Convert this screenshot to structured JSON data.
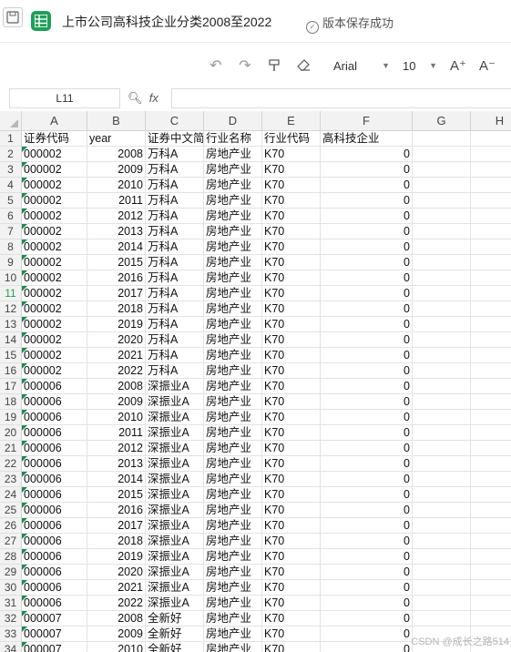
{
  "title_bar": {
    "doc_title": "上市公司高科技企业分类2008至2022",
    "save_status": "版本保存成功",
    "save_icon": "floppy-icon",
    "app_icon": "spreadsheet-app-icon"
  },
  "toolbar": {
    "font_name": "Arial",
    "font_size": "10",
    "undo_icon": "undo-icon",
    "redo_icon": "redo-icon",
    "format_painter_icon": "format-painter-icon",
    "clear_format_icon": "eraser-icon",
    "increase_font": "A⁺",
    "decrease_font": "A⁻"
  },
  "formula_bar": {
    "cell_ref": "L11",
    "zoom_icon": "magnifier-icon",
    "fx_label": "fx",
    "formula": ""
  },
  "columns": [
    "A",
    "B",
    "C",
    "D",
    "E",
    "F",
    "G",
    "H"
  ],
  "selected_row": 11,
  "rows": [
    {
      "n": "1",
      "a": "证券代码",
      "b": "year",
      "c": "证券中文简",
      "d": "行业名称",
      "e": "行业代码",
      "f": "高科技企业",
      "hdr": true
    },
    {
      "n": "2",
      "a": "000002",
      "b": "2008",
      "c": "万科A",
      "d": "房地产业",
      "e": "K70",
      "f": "0"
    },
    {
      "n": "3",
      "a": "000002",
      "b": "2009",
      "c": "万科A",
      "d": "房地产业",
      "e": "K70",
      "f": "0"
    },
    {
      "n": "4",
      "a": "000002",
      "b": "2010",
      "c": "万科A",
      "d": "房地产业",
      "e": "K70",
      "f": "0"
    },
    {
      "n": "5",
      "a": "000002",
      "b": "2011",
      "c": "万科A",
      "d": "房地产业",
      "e": "K70",
      "f": "0"
    },
    {
      "n": "6",
      "a": "000002",
      "b": "2012",
      "c": "万科A",
      "d": "房地产业",
      "e": "K70",
      "f": "0"
    },
    {
      "n": "7",
      "a": "000002",
      "b": "2013",
      "c": "万科A",
      "d": "房地产业",
      "e": "K70",
      "f": "0"
    },
    {
      "n": "8",
      "a": "000002",
      "b": "2014",
      "c": "万科A",
      "d": "房地产业",
      "e": "K70",
      "f": "0"
    },
    {
      "n": "9",
      "a": "000002",
      "b": "2015",
      "c": "万科A",
      "d": "房地产业",
      "e": "K70",
      "f": "0"
    },
    {
      "n": "10",
      "a": "000002",
      "b": "2016",
      "c": "万科A",
      "d": "房地产业",
      "e": "K70",
      "f": "0"
    },
    {
      "n": "11",
      "a": "000002",
      "b": "2017",
      "c": "万科A",
      "d": "房地产业",
      "e": "K70",
      "f": "0"
    },
    {
      "n": "12",
      "a": "000002",
      "b": "2018",
      "c": "万科A",
      "d": "房地产业",
      "e": "K70",
      "f": "0"
    },
    {
      "n": "13",
      "a": "000002",
      "b": "2019",
      "c": "万科A",
      "d": "房地产业",
      "e": "K70",
      "f": "0"
    },
    {
      "n": "14",
      "a": "000002",
      "b": "2020",
      "c": "万科A",
      "d": "房地产业",
      "e": "K70",
      "f": "0"
    },
    {
      "n": "15",
      "a": "000002",
      "b": "2021",
      "c": "万科A",
      "d": "房地产业",
      "e": "K70",
      "f": "0"
    },
    {
      "n": "16",
      "a": "000002",
      "b": "2022",
      "c": "万科A",
      "d": "房地产业",
      "e": "K70",
      "f": "0"
    },
    {
      "n": "17",
      "a": "000006",
      "b": "2008",
      "c": "深振业A",
      "d": "房地产业",
      "e": "K70",
      "f": "0"
    },
    {
      "n": "18",
      "a": "000006",
      "b": "2009",
      "c": "深振业A",
      "d": "房地产业",
      "e": "K70",
      "f": "0"
    },
    {
      "n": "19",
      "a": "000006",
      "b": "2010",
      "c": "深振业A",
      "d": "房地产业",
      "e": "K70",
      "f": "0"
    },
    {
      "n": "20",
      "a": "000006",
      "b": "2011",
      "c": "深振业A",
      "d": "房地产业",
      "e": "K70",
      "f": "0"
    },
    {
      "n": "21",
      "a": "000006",
      "b": "2012",
      "c": "深振业A",
      "d": "房地产业",
      "e": "K70",
      "f": "0"
    },
    {
      "n": "22",
      "a": "000006",
      "b": "2013",
      "c": "深振业A",
      "d": "房地产业",
      "e": "K70",
      "f": "0"
    },
    {
      "n": "23",
      "a": "000006",
      "b": "2014",
      "c": "深振业A",
      "d": "房地产业",
      "e": "K70",
      "f": "0"
    },
    {
      "n": "24",
      "a": "000006",
      "b": "2015",
      "c": "深振业A",
      "d": "房地产业",
      "e": "K70",
      "f": "0"
    },
    {
      "n": "25",
      "a": "000006",
      "b": "2016",
      "c": "深振业A",
      "d": "房地产业",
      "e": "K70",
      "f": "0"
    },
    {
      "n": "26",
      "a": "000006",
      "b": "2017",
      "c": "深振业A",
      "d": "房地产业",
      "e": "K70",
      "f": "0"
    },
    {
      "n": "27",
      "a": "000006",
      "b": "2018",
      "c": "深振业A",
      "d": "房地产业",
      "e": "K70",
      "f": "0"
    },
    {
      "n": "28",
      "a": "000006",
      "b": "2019",
      "c": "深振业A",
      "d": "房地产业",
      "e": "K70",
      "f": "0"
    },
    {
      "n": "29",
      "a": "000006",
      "b": "2020",
      "c": "深振业A",
      "d": "房地产业",
      "e": "K70",
      "f": "0"
    },
    {
      "n": "30",
      "a": "000006",
      "b": "2021",
      "c": "深振业A",
      "d": "房地产业",
      "e": "K70",
      "f": "0"
    },
    {
      "n": "31",
      "a": "000006",
      "b": "2022",
      "c": "深振业A",
      "d": "房地产业",
      "e": "K70",
      "f": "0"
    },
    {
      "n": "32",
      "a": "000007",
      "b": "2008",
      "c": "全新好",
      "d": "房地产业",
      "e": "K70",
      "f": "0"
    },
    {
      "n": "33",
      "a": "000007",
      "b": "2009",
      "c": "全新好",
      "d": "房地产业",
      "e": "K70",
      "f": "0"
    },
    {
      "n": "34",
      "a": "000007",
      "b": "2010",
      "c": "全新好",
      "d": "房地产业",
      "e": "K70",
      "f": "0"
    }
  ],
  "watermark": "CSDN @成长之路514",
  "accent_color": "#1fa05a"
}
